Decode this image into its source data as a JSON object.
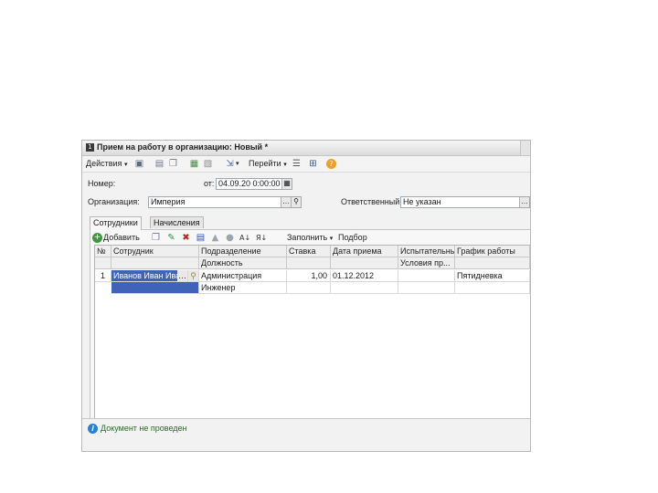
{
  "window": {
    "title": "Прием на работу в организацию: Новый *"
  },
  "toolbar": {
    "actions_label": "Действия",
    "goto_label": "Перейти",
    "dropdown_marker": "▾"
  },
  "header": {
    "number_label": "Номер:",
    "date_prefix": "от:",
    "date_value": "04.09.20 0:00:00",
    "org_label": "Организация:",
    "org_value": "Империя",
    "resp_label": "Ответственный:",
    "resp_value": "Не указан"
  },
  "tabs": [
    {
      "label": "Сотрудники"
    },
    {
      "label": "Начисления"
    }
  ],
  "grid_toolbar": {
    "add_label": "Добавить",
    "fill_label": "Заполнить",
    "select_label": "Подбор"
  },
  "grid": {
    "headers_top": [
      "№",
      "Сотрудник",
      "Подразделение",
      "Ставка",
      "Дата приема",
      "Испытательны...",
      "График работы"
    ],
    "headers_bottom": [
      "",
      "",
      "Должность",
      "",
      "",
      "Условия пр...",
      ""
    ],
    "rows": [
      {
        "num": "1",
        "employee": "Иванов Иван Ива",
        "department": "Администрация",
        "position": "Инженер",
        "rate": "1,00",
        "hire_date": "01.12.2012",
        "probation": "",
        "probation_cond": "",
        "schedule": "Пятидневка"
      }
    ]
  },
  "status": {
    "text": "Документ не проведен"
  },
  "colors": {
    "selected_cell": "#3f63b8",
    "status_icon": "#2a7fd4",
    "delete_icon": "#d02020",
    "help_icon": "#f0a020"
  }
}
